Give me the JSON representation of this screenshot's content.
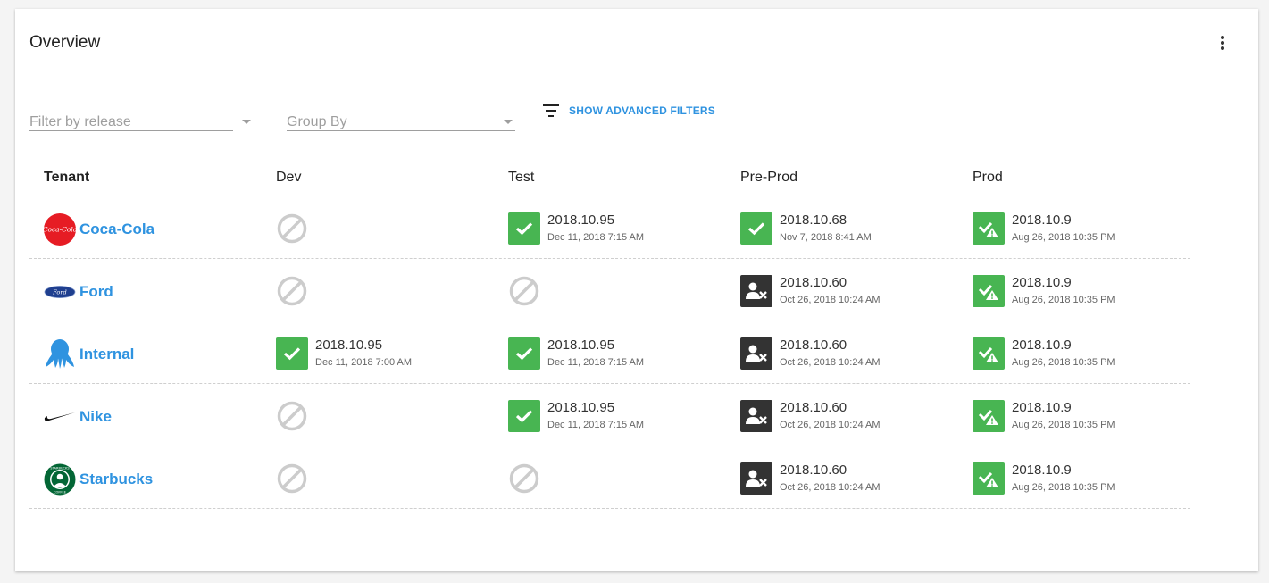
{
  "card": {
    "title": "Overview"
  },
  "filters": {
    "release_placeholder": "Filter by release",
    "groupby_placeholder": "Group By",
    "advanced_label": "SHOW ADVANCED FILTERS"
  },
  "table": {
    "headers": [
      "Tenant",
      "Dev",
      "Test",
      "Pre-Prod",
      "Prod"
    ],
    "rows": [
      {
        "tenant": "Coca-Cola",
        "logo": "coca-cola-logo",
        "cells": [
          {
            "status": "none"
          },
          {
            "status": "success",
            "version": "2018.10.95",
            "date": "Dec 11, 2018 7:15 AM"
          },
          {
            "status": "success",
            "version": "2018.10.68",
            "date": "Nov 7, 2018 8:41 AM"
          },
          {
            "status": "success-warning",
            "version": "2018.10.9",
            "date": "Aug 26, 2018 10:35 PM"
          }
        ]
      },
      {
        "tenant": "Ford",
        "logo": "ford-logo",
        "cells": [
          {
            "status": "none"
          },
          {
            "status": "none"
          },
          {
            "status": "failed",
            "version": "2018.10.60",
            "date": "Oct 26, 2018 10:24 AM"
          },
          {
            "status": "success-warning",
            "version": "2018.10.9",
            "date": "Aug 26, 2018 10:35 PM"
          }
        ]
      },
      {
        "tenant": "Internal",
        "logo": "octopus-logo",
        "cells": [
          {
            "status": "success",
            "version": "2018.10.95",
            "date": "Dec 11, 2018 7:00 AM"
          },
          {
            "status": "success",
            "version": "2018.10.95",
            "date": "Dec 11, 2018 7:15 AM"
          },
          {
            "status": "failed",
            "version": "2018.10.60",
            "date": "Oct 26, 2018 10:24 AM"
          },
          {
            "status": "success-warning",
            "version": "2018.10.9",
            "date": "Aug 26, 2018 10:35 PM"
          }
        ]
      },
      {
        "tenant": "Nike",
        "logo": "nike-logo",
        "cells": [
          {
            "status": "none"
          },
          {
            "status": "success",
            "version": "2018.10.95",
            "date": "Dec 11, 2018 7:15 AM"
          },
          {
            "status": "failed",
            "version": "2018.10.60",
            "date": "Oct 26, 2018 10:24 AM"
          },
          {
            "status": "success-warning",
            "version": "2018.10.9",
            "date": "Aug 26, 2018 10:35 PM"
          }
        ]
      },
      {
        "tenant": "Starbucks",
        "logo": "starbucks-logo",
        "cells": [
          {
            "status": "none"
          },
          {
            "status": "none"
          },
          {
            "status": "failed",
            "version": "2018.10.60",
            "date": "Oct 26, 2018 10:24 AM"
          },
          {
            "status": "success-warning",
            "version": "2018.10.9",
            "date": "Aug 26, 2018 10:35 PM"
          }
        ]
      }
    ]
  },
  "colors": {
    "accent": "#2f93e0",
    "success": "#48b552",
    "failed": "#333333",
    "none": "#cccccc"
  },
  "logo_texts": {
    "coca_cola": "Coca-Cola",
    "ford": "Ford",
    "starbucks_top": "STARBUCKS",
    "starbucks_bottom": "COFFEE"
  }
}
